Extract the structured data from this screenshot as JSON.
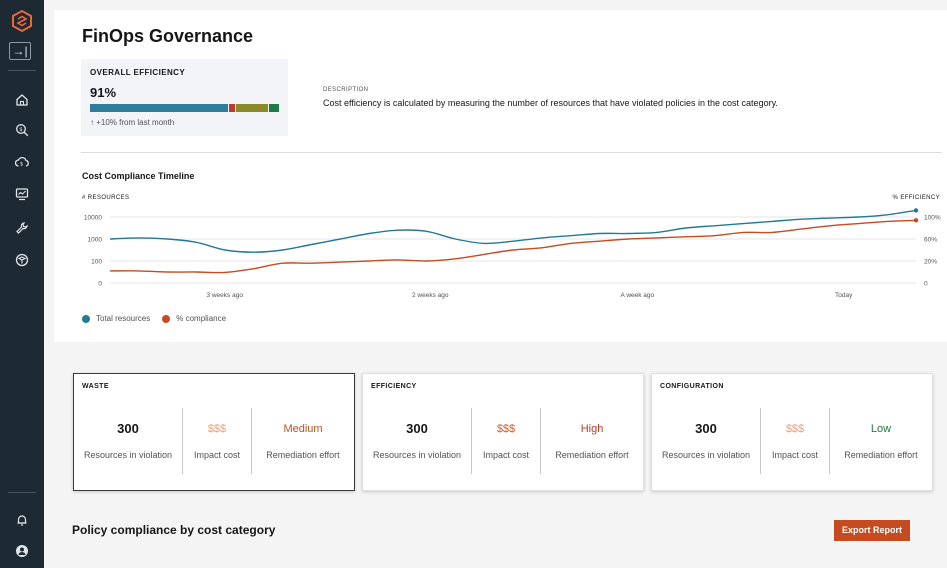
{
  "sidebar": {
    "expand_label": "→|",
    "icons": [
      "home-icon",
      "search-cost-icon",
      "cloud-icon",
      "dashboard-icon",
      "wrench-icon",
      "cube-icon",
      "bell-icon",
      "user-icon"
    ]
  },
  "page": {
    "title": "FinOps Governance"
  },
  "efficiency": {
    "label": "OVERALL EFFICIENCY",
    "value": "91%",
    "change": "↑ +10% from last month",
    "segments": [
      {
        "fraction": 0.73,
        "color": "#2e7d9a"
      },
      {
        "fraction": 0.035,
        "color": "#c0392b"
      },
      {
        "fraction": 0.17,
        "color": "#8a8a2a"
      },
      {
        "fraction": 0.055,
        "color": "#1e7a4a"
      }
    ]
  },
  "description": {
    "label": "DESCRIPTION",
    "text": "Cost efficiency is calculated by measuring the number of resources that have violated policies in the cost category."
  },
  "timeline": {
    "title": "Cost Compliance Timeline",
    "left_axis_title": "# RESOURCES",
    "right_axis_title": "% EFFICIENCY"
  },
  "chart_data": {
    "type": "line",
    "title": "Cost Compliance Timeline",
    "y_left_label": "# RESOURCES",
    "y_right_label": "% EFFICIENCY",
    "y_left_ticks": [
      "10000",
      "1000",
      "100",
      "0"
    ],
    "y_right_ticks": [
      "100%",
      "60%",
      "20%",
      "0"
    ],
    "x_ticks": [
      "3 weeks ago",
      "2 weeks ago",
      "A week ago",
      "Today"
    ],
    "x": [
      0,
      1,
      2,
      3,
      4,
      5,
      6,
      7,
      8,
      9,
      10,
      11,
      12,
      13,
      14,
      15,
      16,
      17,
      18,
      19,
      20,
      21,
      22,
      23,
      24,
      25,
      26,
      27,
      28
    ],
    "series": [
      {
        "name": "Total resources",
        "color": "#237a94",
        "y_left_pos": [
          2.0,
          2.05,
          2.0,
          1.85,
          1.5,
          1.4,
          1.5,
          1.75,
          2.0,
          2.25,
          2.4,
          2.35,
          2.0,
          1.8,
          1.9,
          2.05,
          2.15,
          2.25,
          2.25,
          2.3,
          2.5,
          2.6,
          2.7,
          2.8,
          2.9,
          2.95,
          3.0,
          3.1,
          3.3
        ]
      },
      {
        "name": "% compliance",
        "color": "#c54b20",
        "y_left_pos": [
          0.55,
          0.55,
          0.5,
          0.5,
          0.48,
          0.65,
          0.9,
          0.9,
          0.95,
          1.0,
          1.05,
          1.0,
          1.1,
          1.3,
          1.5,
          1.6,
          1.8,
          1.9,
          2.0,
          2.05,
          2.1,
          2.15,
          2.3,
          2.3,
          2.45,
          2.6,
          2.7,
          2.8,
          2.85
        ]
      }
    ],
    "grid": true,
    "legend": "bottom-left"
  },
  "legend": [
    {
      "label": "Total resources",
      "color": "#237a94"
    },
    {
      "label": "% compliance",
      "color": "#c54b20"
    }
  ],
  "categories": [
    {
      "title": "WASTE",
      "selected": true,
      "count": "300",
      "count_label": "Resources in violation",
      "impact": "$$$",
      "impact_label": "Impact cost",
      "impact_color": "#e8a07a",
      "effort": "Medium",
      "effort_label": "Remediation effort",
      "effort_color": "#b8541e"
    },
    {
      "title": "EFFICIENCY",
      "selected": false,
      "count": "300",
      "count_label": "Resources in violation",
      "impact": "$$$",
      "impact_label": "Impact cost",
      "impact_color": "#d45a2a",
      "effort": "High",
      "effort_label": "Remediation effort",
      "effort_color": "#c0392b"
    },
    {
      "title": "CONFIGURATION",
      "selected": false,
      "count": "300",
      "count_label": "Resources in violation",
      "impact": "$$$",
      "impact_label": "Impact cost",
      "impact_color": "#e8a07a",
      "effort": "Low",
      "effort_label": "Remediation effort",
      "effort_color": "#1e7a4a"
    }
  ],
  "policy": {
    "title": "Policy compliance by cost category",
    "export_label": "Export Report"
  }
}
